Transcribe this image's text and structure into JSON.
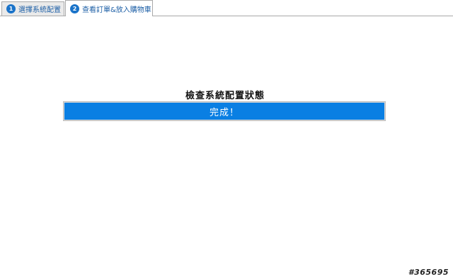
{
  "tabs": [
    {
      "step": "1",
      "label": "選擇系統配置",
      "active": false
    },
    {
      "step": "2",
      "label": "查看訂單&放入購物車",
      "active": true
    }
  ],
  "status": {
    "title": "檢查系統配置狀態",
    "message": "完成！",
    "progress_fraction": 1.0
  },
  "colors": {
    "accent": "#0a7fe3",
    "badge": "#1a73c9",
    "tab_text": "#1d5fa6"
  },
  "icons": {
    "step_badge": "numbered-circle-icon"
  },
  "corner_id": "#365695"
}
